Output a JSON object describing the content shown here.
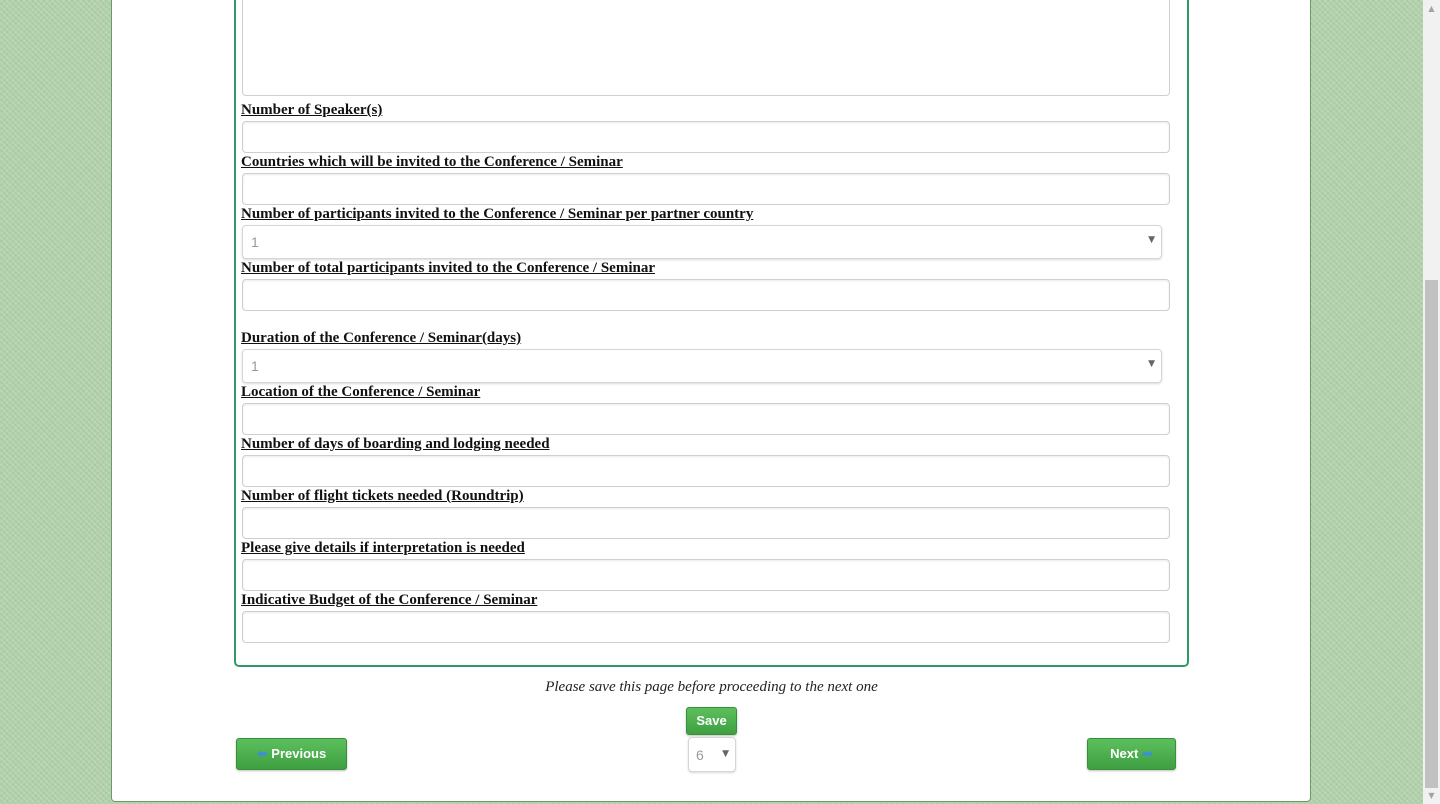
{
  "form": {
    "fields": [
      {
        "label": "Number of Speaker(s)",
        "type": "text",
        "value": ""
      },
      {
        "label": "Countries which will be invited to the Conference / Seminar",
        "type": "text",
        "value": ""
      },
      {
        "label": "Number of participants invited to the Conference / Seminar per partner country",
        "type": "select",
        "value": "1"
      },
      {
        "label": "Number of total participants invited to the Conference / Seminar",
        "type": "text",
        "value": ""
      },
      {
        "label": "Duration of the Conference / Seminar(days)",
        "type": "select",
        "value": "1"
      },
      {
        "label": "Location of the Conference / Seminar",
        "type": "text",
        "value": ""
      },
      {
        "label": "Number of days of boarding and lodging needed",
        "type": "text",
        "value": ""
      },
      {
        "label": "Number of flight tickets needed (Roundtrip)",
        "type": "text",
        "value": ""
      },
      {
        "label": "Please give details if interpretation is needed",
        "type": "text",
        "value": ""
      },
      {
        "label": "Indicative Budget of the Conference / Seminar",
        "type": "text",
        "value": ""
      }
    ]
  },
  "footer": {
    "note": "Please save this page before proceeding to the next one",
    "save_label": "Save",
    "previous_label": "Previous",
    "next_label": "Next",
    "page_select_value": "6"
  },
  "icons": {
    "previous": "arrow-left-icon",
    "next": "arrow-right-icon",
    "dropdown": "chevron-down-icon"
  },
  "colors": {
    "background": "#b3d4ac",
    "panel_border": "#2e9a6a",
    "button_green": "#4cae4f",
    "arrow_blue": "#3b8fd8"
  }
}
